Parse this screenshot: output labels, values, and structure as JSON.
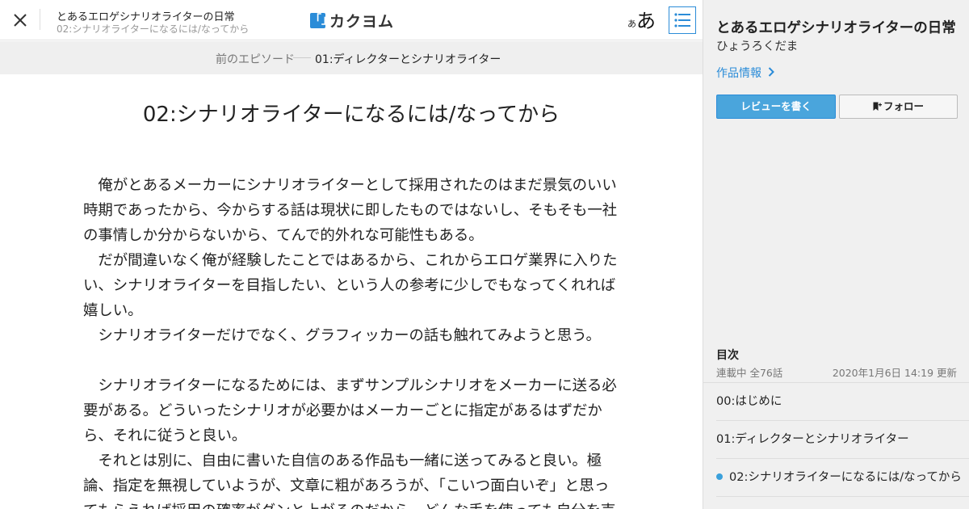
{
  "header": {
    "work_title": "とあるエロゲシナリオライターの日常",
    "episode_subtitle": "02:シナリオライターになるには/なってから",
    "logo_mark": "「」",
    "logo_text": "カクヨム",
    "font_small": "あ",
    "font_big": "あ",
    "accent_color": "#2b8cd8"
  },
  "episode_nav": {
    "prev_label": "前のエピソード",
    "prev_title": "01:ディレクターとシナリオライター"
  },
  "episode": {
    "title": "02:シナリオライターになるには/なってから",
    "lines": [
      "　俺がとあるメーカーにシナリオライターとして採用されたのはまだ景気のいい",
      "時期であったから、今からする話は現状に即したものではないし、そもそも一社",
      "の事情しか分からないから、てんで的外れな可能性もある。",
      "　だが間違いなく俺が経験したことではあるから、これからエロゲ業界に入りた",
      "い、シナリオライターを目指したい、という人の参考に少しでもなってくれれば",
      "嬉しい。",
      "　シナリオライターだけでなく、グラフィッカーの話も触れてみようと思う。",
      "",
      "　シナリオライターになるためには、まずサンプルシナリオをメーカーに送る必",
      "要がある。どういったシナリオが必要かはメーカーごとに指定があるはずだか",
      "ら、それに従うと良い。",
      "　それとは別に、自由に書いた自信のある作品も一緒に送ってみると良い。極",
      "論、指定を無視していようが、文章に粗があろうが、「こいつ面白いぞ」と思っ",
      "てもらえれば採用の確率がグンと上がるのだから、どんな手を使っても自分を売"
    ]
  },
  "sidebar": {
    "work_title": "とあるエロゲシナリオライターの日常",
    "author": "ひょうろくだま",
    "info_link": "作品情報",
    "review_button": "レビューを書く",
    "follow_button": "フォロー",
    "toc_heading": "目次",
    "toc_status": "連載中 全76話",
    "toc_updated": "2020年1月6日 14:19 更新",
    "toc_items": [
      {
        "title": "00:はじめに",
        "current": false
      },
      {
        "title": "01:ディレクターとシナリオライター",
        "current": false
      },
      {
        "title": "02:シナリオライターになるには/なってから",
        "current": true
      }
    ]
  }
}
